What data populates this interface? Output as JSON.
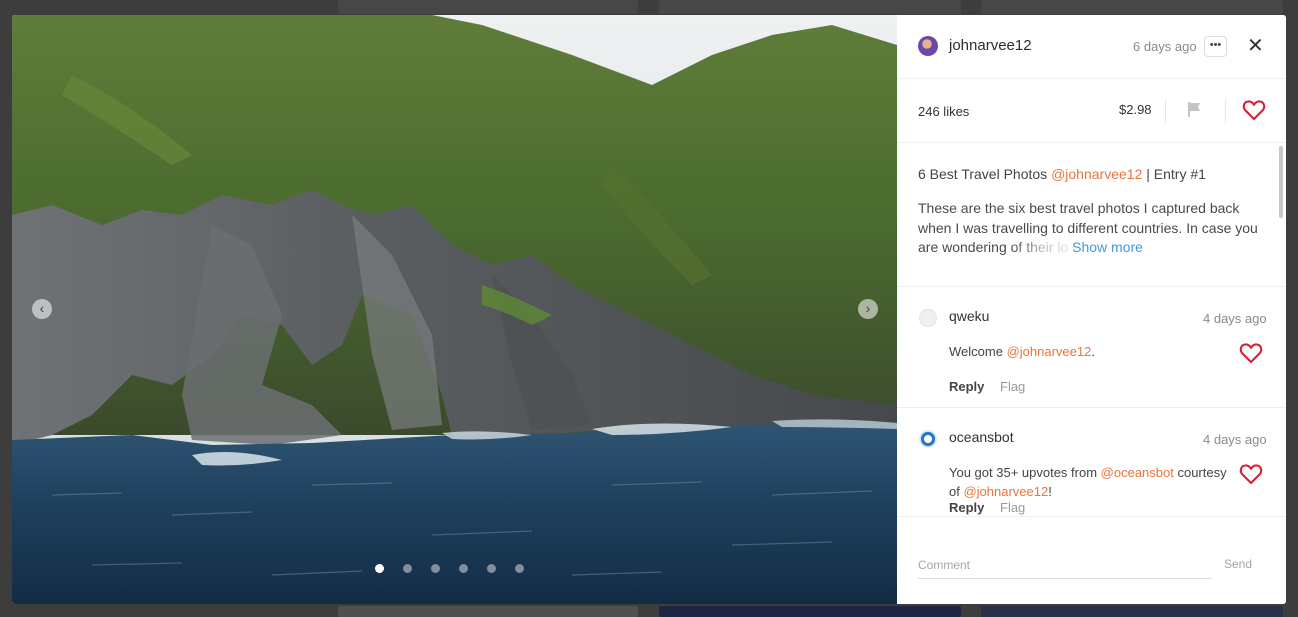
{
  "post": {
    "username": "johnarvee12",
    "time_ago": "6 days ago",
    "more_label": "•••",
    "close_label": "✕",
    "likes": "246 likes",
    "payout": "$2.98",
    "title_prefix": "6 Best Travel Photos ",
    "title_mention": "@johnarvee12",
    "title_suffix": " | Entry #1",
    "body_visible": "These are the six best travel photos I captured back when I was travelling to different countries. In case you are wondering ",
    "body_faded": "of their lo",
    "show_more": "Show more"
  },
  "gallery": {
    "prev_label": "‹",
    "next_label": "›",
    "slide_count": 6,
    "active_slide": 1
  },
  "comments": [
    {
      "username": "qweku",
      "time_ago": "4 days ago",
      "text_prefix": "Welcome ",
      "mention": "@johnarvee12",
      "text_suffix": ".",
      "reply_label": "Reply",
      "flag_label": "Flag"
    },
    {
      "username": "oceansbot",
      "time_ago": "4 days ago",
      "text_prefix": "You got 35+ upvotes from ",
      "mention": "@oceansbot",
      "text_mid": " courtesy of ",
      "mention2": "@johnarvee12",
      "text_suffix": "!",
      "reply_label": "Reply",
      "flag_label": "Flag"
    }
  ],
  "composer": {
    "placeholder": "Comment",
    "send_label": "Send"
  },
  "colors": {
    "accent_mention": "#e8763b",
    "heart": "#d91e36",
    "link": "#3f9ad8"
  },
  "icons": [
    "avatar",
    "more-icon",
    "close-icon",
    "flag-icon",
    "heart-icon",
    "chevron-left-icon",
    "chevron-right-icon"
  ]
}
